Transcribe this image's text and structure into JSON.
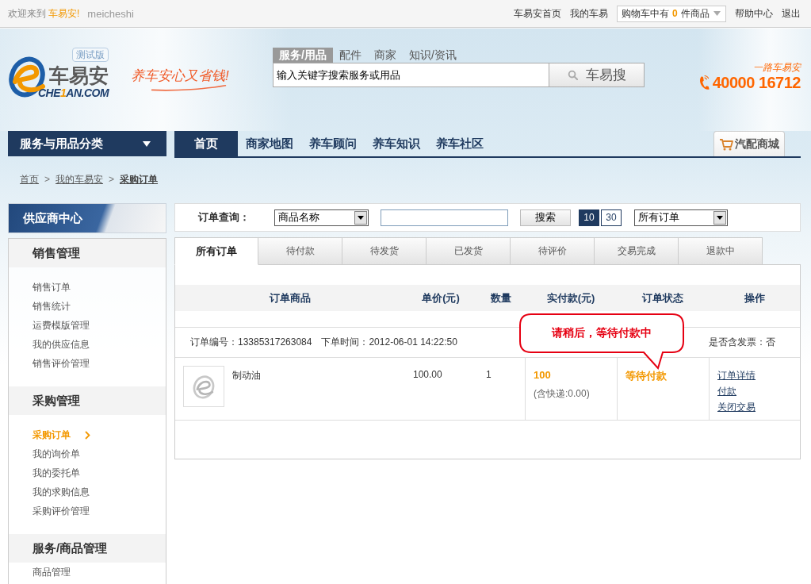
{
  "top_bar": {
    "welcome": "欢迎来到",
    "site_name": "车易安!",
    "username": "meicheshi",
    "links": [
      "车易安首页",
      "我的车易"
    ],
    "cart": {
      "prefix": "购物车中有",
      "count": "0",
      "suffix": "件商品"
    },
    "links_right": [
      "帮助中心",
      "退出"
    ]
  },
  "header": {
    "logo": {
      "name": "车易安",
      "domain_start": "CHE",
      "domain_highlight": "1",
      "domain_end": "AN.COM",
      "badge": "测试版"
    },
    "slogan": "养车安心又省钱!",
    "search": {
      "tabs": [
        {
          "label": "服务/用品",
          "selected": true
        },
        {
          "label": "配件",
          "selected": false
        },
        {
          "label": "商家",
          "selected": false
        },
        {
          "label": "知识/资讯",
          "selected": false
        }
      ],
      "placeholder": "输入关键字搜索服务或用品",
      "button": "车易搜"
    },
    "hotline": {
      "tagline": "一路车易安",
      "number": "40000 16712"
    }
  },
  "nav": {
    "category_menu": "服务与用品分类",
    "items": [
      {
        "label": "首页",
        "selected": true
      },
      {
        "label": "商家地图",
        "selected": false
      },
      {
        "label": "养车顾问",
        "selected": false
      },
      {
        "label": "养车知识",
        "selected": false
      },
      {
        "label": "养车社区",
        "selected": false
      }
    ],
    "mall_button": "汽配商城"
  },
  "breadcrumb": {
    "separator": ">",
    "items": [
      {
        "label": "首页",
        "current": false
      },
      {
        "label": "我的车易安",
        "current": false
      },
      {
        "label": "采购订单",
        "current": true
      }
    ]
  },
  "sidebar": {
    "title": "供应商中心",
    "sections": [
      {
        "heading": "销售管理",
        "items": [
          {
            "label": "销售订单",
            "selected": false
          },
          {
            "label": "销售统计",
            "selected": false
          },
          {
            "label": "运费模版管理",
            "selected": false
          },
          {
            "label": "我的供应信息",
            "selected": false
          },
          {
            "label": "销售评价管理",
            "selected": false
          }
        ]
      },
      {
        "heading": "采购管理",
        "items": [
          {
            "label": "采购订单",
            "selected": true
          },
          {
            "label": "我的询价单",
            "selected": false
          },
          {
            "label": "我的委托单",
            "selected": false
          },
          {
            "label": "我的求购信息",
            "selected": false
          },
          {
            "label": "采购评价管理",
            "selected": false
          }
        ]
      },
      {
        "heading": "服务/商品管理",
        "items": [
          {
            "label": "商品管理",
            "selected": false
          }
        ]
      }
    ]
  },
  "query_bar": {
    "label": "订单查询：",
    "field_select": "商品名称",
    "search_button": "搜索",
    "page_sizes": [
      {
        "label": "10",
        "selected": true
      },
      {
        "label": "30",
        "selected": false
      }
    ],
    "status_select": "所有订单"
  },
  "order_tabs": [
    {
      "label": "所有订单",
      "selected": true
    },
    {
      "label": "待付款",
      "selected": false
    },
    {
      "label": "待发货",
      "selected": false
    },
    {
      "label": "已发货",
      "selected": false
    },
    {
      "label": "待评价",
      "selected": false
    },
    {
      "label": "交易完成",
      "selected": false
    },
    {
      "label": "退款中",
      "selected": false
    }
  ],
  "order_table": {
    "columns": [
      "订单商品",
      "单价(元)",
      "数量",
      "实付款(元)",
      "订单状态",
      "操作"
    ],
    "orders": [
      {
        "number": "订单编号：13385317263084",
        "time": "下单时间：2012-06-01 14:22:50",
        "invoice": "是否含发票：否",
        "product": "制动油",
        "unit_price": "100.00",
        "quantity": "1",
        "paid": "100",
        "shipping_note": "(含快递:0.00)",
        "status": "等待付款",
        "actions": [
          "订单详情",
          "付款",
          "关闭交易"
        ]
      }
    ]
  },
  "callout": "请稍后，等待付款中"
}
